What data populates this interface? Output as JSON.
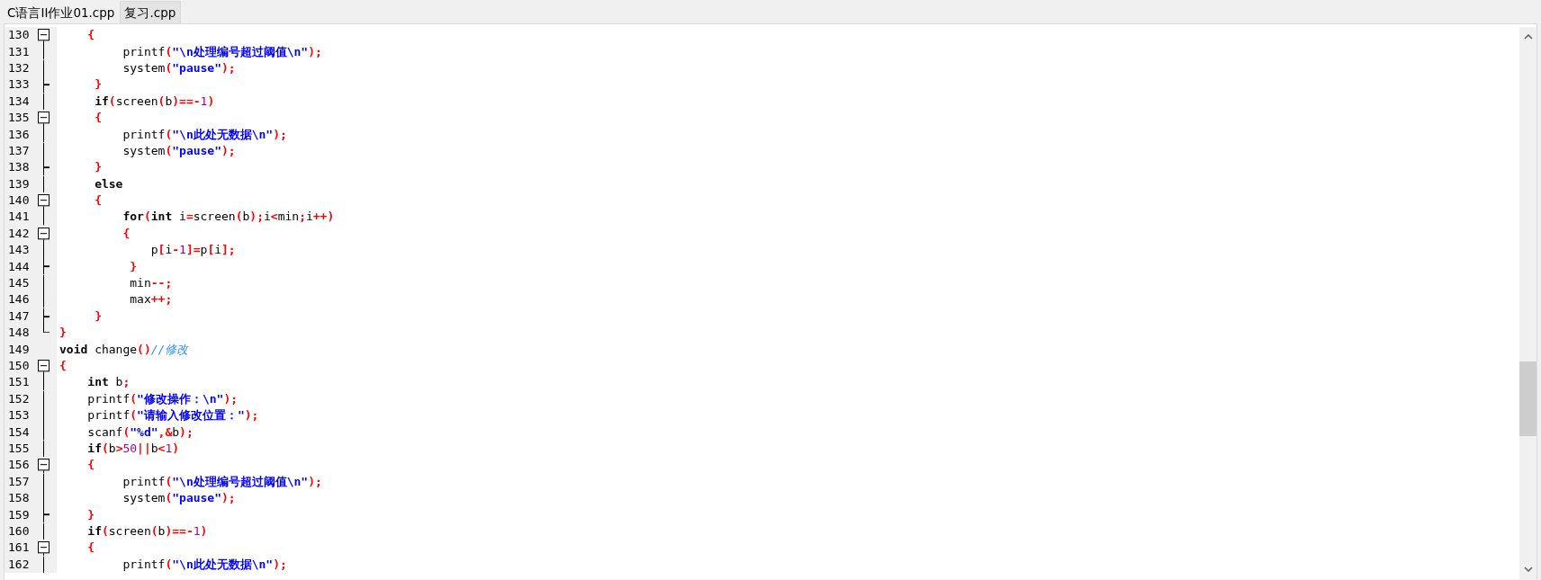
{
  "tabs": [
    {
      "label": "C语言II作业01.cpp",
      "selected": true
    },
    {
      "label": "复习.cpp",
      "selected": false
    }
  ],
  "editor": {
    "lines": [
      {
        "number": "130",
        "kind": "start",
        "tokens": [
          {
            "kind": "op",
            "text": "    {"
          }
        ]
      },
      {
        "number": "131",
        "kind": "body",
        "tokens": [
          {
            "kind": "id",
            "text": "         printf"
          },
          {
            "kind": "op",
            "text": "("
          },
          {
            "kind": "str",
            "text": "\"\\n处理编号超过阈值\\n\""
          },
          {
            "kind": "op",
            "text": ");"
          }
        ]
      },
      {
        "number": "132",
        "kind": "body",
        "tokens": [
          {
            "kind": "id",
            "text": "         system"
          },
          {
            "kind": "op",
            "text": "("
          },
          {
            "kind": "str",
            "text": "\"pause\""
          },
          {
            "kind": "op",
            "text": ");"
          }
        ]
      },
      {
        "number": "133",
        "kind": "end",
        "tokens": [
          {
            "kind": "op",
            "text": "     }"
          }
        ]
      },
      {
        "number": "134",
        "kind": "body",
        "tokens": [
          {
            "kind": "kw",
            "text": "     if"
          },
          {
            "kind": "op",
            "text": "("
          },
          {
            "kind": "id",
            "text": "screen"
          },
          {
            "kind": "op",
            "text": "("
          },
          {
            "kind": "id",
            "text": "b"
          },
          {
            "kind": "op",
            "text": ")==-"
          },
          {
            "kind": "num",
            "text": "1"
          },
          {
            "kind": "op",
            "text": ")"
          }
        ]
      },
      {
        "number": "135",
        "kind": "start",
        "tokens": [
          {
            "kind": "op",
            "text": "     {"
          }
        ]
      },
      {
        "number": "136",
        "kind": "body",
        "tokens": [
          {
            "kind": "id",
            "text": "         printf"
          },
          {
            "kind": "op",
            "text": "("
          },
          {
            "kind": "str",
            "text": "\"\\n此处无数据\\n\""
          },
          {
            "kind": "op",
            "text": ");"
          }
        ]
      },
      {
        "number": "137",
        "kind": "body",
        "tokens": [
          {
            "kind": "id",
            "text": "         system"
          },
          {
            "kind": "op",
            "text": "("
          },
          {
            "kind": "str",
            "text": "\"pause\""
          },
          {
            "kind": "op",
            "text": ");"
          }
        ]
      },
      {
        "number": "138",
        "kind": "end",
        "tokens": [
          {
            "kind": "op",
            "text": "     }"
          }
        ]
      },
      {
        "number": "139",
        "kind": "body",
        "tokens": [
          {
            "kind": "kw",
            "text": "     else"
          }
        ]
      },
      {
        "number": "140",
        "kind": "start",
        "tokens": [
          {
            "kind": "op",
            "text": "     {"
          }
        ]
      },
      {
        "number": "141",
        "kind": "body",
        "tokens": [
          {
            "kind": "kw",
            "text": "         for"
          },
          {
            "kind": "op",
            "text": "("
          },
          {
            "kind": "kw",
            "text": "int"
          },
          {
            "kind": "id",
            "text": " i"
          },
          {
            "kind": "op",
            "text": "="
          },
          {
            "kind": "id",
            "text": "screen"
          },
          {
            "kind": "op",
            "text": "("
          },
          {
            "kind": "id",
            "text": "b"
          },
          {
            "kind": "op",
            "text": ");"
          },
          {
            "kind": "id",
            "text": "i"
          },
          {
            "kind": "op",
            "text": "<"
          },
          {
            "kind": "id",
            "text": "min"
          },
          {
            "kind": "op",
            "text": ";"
          },
          {
            "kind": "id",
            "text": "i"
          },
          {
            "kind": "op",
            "text": "++)"
          }
        ]
      },
      {
        "number": "142",
        "kind": "start",
        "tokens": [
          {
            "kind": "op",
            "text": "         {"
          }
        ]
      },
      {
        "number": "143",
        "kind": "body",
        "tokens": [
          {
            "kind": "id",
            "text": "             p"
          },
          {
            "kind": "op",
            "text": "["
          },
          {
            "kind": "id",
            "text": "i"
          },
          {
            "kind": "op",
            "text": "-"
          },
          {
            "kind": "num",
            "text": "1"
          },
          {
            "kind": "op",
            "text": "]="
          },
          {
            "kind": "id",
            "text": "p"
          },
          {
            "kind": "op",
            "text": "["
          },
          {
            "kind": "id",
            "text": "i"
          },
          {
            "kind": "op",
            "text": "];"
          }
        ]
      },
      {
        "number": "144",
        "kind": "end",
        "tokens": [
          {
            "kind": "op",
            "text": "          }"
          }
        ]
      },
      {
        "number": "145",
        "kind": "body",
        "tokens": [
          {
            "kind": "id",
            "text": "          min"
          },
          {
            "kind": "op",
            "text": "--;"
          }
        ]
      },
      {
        "number": "146",
        "kind": "body",
        "tokens": [
          {
            "kind": "id",
            "text": "          max"
          },
          {
            "kind": "op",
            "text": "++;"
          }
        ]
      },
      {
        "number": "147",
        "kind": "end",
        "tokens": [
          {
            "kind": "op",
            "text": "     }"
          }
        ]
      },
      {
        "number": "148",
        "kind": "last",
        "tokens": [
          {
            "kind": "op",
            "text": "}"
          }
        ]
      },
      {
        "number": "149",
        "kind": "plain",
        "tokens": [
          {
            "kind": "kw",
            "text": "void"
          },
          {
            "kind": "id",
            "text": " change"
          },
          {
            "kind": "op",
            "text": "()"
          },
          {
            "kind": "cmt",
            "text": "//修改"
          }
        ]
      },
      {
        "number": "150",
        "kind": "start",
        "tokens": [
          {
            "kind": "op",
            "text": "{"
          }
        ]
      },
      {
        "number": "151",
        "kind": "body",
        "tokens": [
          {
            "kind": "kw",
            "text": "    int"
          },
          {
            "kind": "id",
            "text": " b"
          },
          {
            "kind": "op",
            "text": ";"
          }
        ]
      },
      {
        "number": "152",
        "kind": "body",
        "tokens": [
          {
            "kind": "id",
            "text": "    printf"
          },
          {
            "kind": "op",
            "text": "("
          },
          {
            "kind": "str",
            "text": "\"修改操作：\\n\""
          },
          {
            "kind": "op",
            "text": ");"
          }
        ]
      },
      {
        "number": "153",
        "kind": "body",
        "tokens": [
          {
            "kind": "id",
            "text": "    printf"
          },
          {
            "kind": "op",
            "text": "("
          },
          {
            "kind": "str",
            "text": "\"请输入修改位置：\""
          },
          {
            "kind": "op",
            "text": ");"
          }
        ]
      },
      {
        "number": "154",
        "kind": "body",
        "tokens": [
          {
            "kind": "id",
            "text": "    scanf"
          },
          {
            "kind": "op",
            "text": "("
          },
          {
            "kind": "str",
            "text": "\"%d\""
          },
          {
            "kind": "op",
            "text": ",&"
          },
          {
            "kind": "id",
            "text": "b"
          },
          {
            "kind": "op",
            "text": ");"
          }
        ]
      },
      {
        "number": "155",
        "kind": "body",
        "tokens": [
          {
            "kind": "kw",
            "text": "    if"
          },
          {
            "kind": "op",
            "text": "("
          },
          {
            "kind": "id",
            "text": "b"
          },
          {
            "kind": "op",
            "text": ">"
          },
          {
            "kind": "num",
            "text": "50"
          },
          {
            "kind": "op",
            "text": "||"
          },
          {
            "kind": "id",
            "text": "b"
          },
          {
            "kind": "op",
            "text": "<"
          },
          {
            "kind": "num",
            "text": "1"
          },
          {
            "kind": "op",
            "text": ")"
          }
        ]
      },
      {
        "number": "156",
        "kind": "start",
        "tokens": [
          {
            "kind": "op",
            "text": "    {"
          }
        ]
      },
      {
        "number": "157",
        "kind": "body",
        "tokens": [
          {
            "kind": "id",
            "text": "         printf"
          },
          {
            "kind": "op",
            "text": "("
          },
          {
            "kind": "str",
            "text": "\"\\n处理编号超过阈值\\n\""
          },
          {
            "kind": "op",
            "text": ");"
          }
        ]
      },
      {
        "number": "158",
        "kind": "body",
        "tokens": [
          {
            "kind": "id",
            "text": "         system"
          },
          {
            "kind": "op",
            "text": "("
          },
          {
            "kind": "str",
            "text": "\"pause\""
          },
          {
            "kind": "op",
            "text": ");"
          }
        ]
      },
      {
        "number": "159",
        "kind": "end",
        "tokens": [
          {
            "kind": "op",
            "text": "    }"
          }
        ]
      },
      {
        "number": "160",
        "kind": "body",
        "tokens": [
          {
            "kind": "kw",
            "text": "    if"
          },
          {
            "kind": "op",
            "text": "("
          },
          {
            "kind": "id",
            "text": "screen"
          },
          {
            "kind": "op",
            "text": "("
          },
          {
            "kind": "id",
            "text": "b"
          },
          {
            "kind": "op",
            "text": ")==-"
          },
          {
            "kind": "num",
            "text": "1"
          },
          {
            "kind": "op",
            "text": ")"
          }
        ]
      },
      {
        "number": "161",
        "kind": "start",
        "tokens": [
          {
            "kind": "op",
            "text": "    {"
          }
        ]
      },
      {
        "number": "162",
        "kind": "body",
        "tokens": [
          {
            "kind": "id",
            "text": "         printf"
          },
          {
            "kind": "op",
            "text": "("
          },
          {
            "kind": "str",
            "text": "\"\\n此处无数据\\n\""
          },
          {
            "kind": "op",
            "text": ");"
          }
        ]
      }
    ]
  }
}
